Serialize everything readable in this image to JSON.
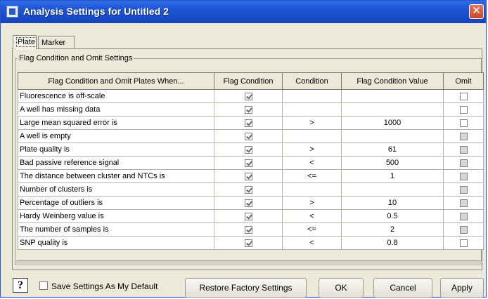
{
  "window": {
    "title": "Analysis Settings for Untitled 2",
    "close_glyph": "✕",
    "app_icon": "dialog-icon"
  },
  "tabs": [
    {
      "label": "Plate",
      "selected": true
    },
    {
      "label": "Marker",
      "selected": false
    }
  ],
  "group": {
    "title": "Flag Condition and Omit Settings"
  },
  "table": {
    "headers": [
      "Flag Condition and Omit Plates When...",
      "Flag Condition",
      "Condition",
      "Flag Condition Value",
      "Omit"
    ],
    "rows": [
      {
        "label": "Fluorescence is off-scale",
        "flag": true,
        "condition": "",
        "value": "",
        "omit": false,
        "omit_enabled": true
      },
      {
        "label": "A well has missing data",
        "flag": true,
        "condition": "",
        "value": "",
        "omit": false,
        "omit_enabled": true
      },
      {
        "label": "Large mean squared error is",
        "flag": true,
        "condition": ">",
        "value": "1000",
        "omit": false,
        "omit_enabled": true
      },
      {
        "label": "A well is empty",
        "flag": true,
        "condition": "",
        "value": "",
        "omit": false,
        "omit_enabled": false
      },
      {
        "label": "Plate quality is",
        "flag": true,
        "condition": ">",
        "value": "61",
        "omit": false,
        "omit_enabled": false
      },
      {
        "label": "Bad passive reference signal",
        "flag": true,
        "condition": "<",
        "value": "500",
        "omit": false,
        "omit_enabled": false
      },
      {
        "label": "The distance between cluster and NTCs is",
        "flag": true,
        "condition": "<=",
        "value": "1",
        "omit": false,
        "omit_enabled": false
      },
      {
        "label": "Number of clusters is",
        "flag": true,
        "condition": "",
        "value": "",
        "omit": false,
        "omit_enabled": false
      },
      {
        "label": "Percentage of outliers is",
        "flag": true,
        "condition": ">",
        "value": "10",
        "omit": false,
        "omit_enabled": false
      },
      {
        "label": "Hardy Weinberg value is",
        "flag": true,
        "condition": "<",
        "value": "0.5",
        "omit": false,
        "omit_enabled": false
      },
      {
        "label": "The number of samples is",
        "flag": true,
        "condition": "<=",
        "value": "2",
        "omit": false,
        "omit_enabled": false
      },
      {
        "label": "SNP quality is",
        "flag": true,
        "condition": "<",
        "value": "0.8",
        "omit": false,
        "omit_enabled": true
      }
    ]
  },
  "footer": {
    "help_glyph": "?",
    "save_default_label": "Save Settings As My Default",
    "save_default_checked": false,
    "restore_label": "Restore Factory Settings",
    "ok_label": "OK",
    "cancel_label": "Cancel",
    "apply_label": "Apply"
  },
  "colors": {
    "titlebar": "#1e56d6",
    "dialog_bg": "#ece9d8",
    "disabled_cell": "#bdbdbd",
    "close_button": "#d9583a"
  }
}
